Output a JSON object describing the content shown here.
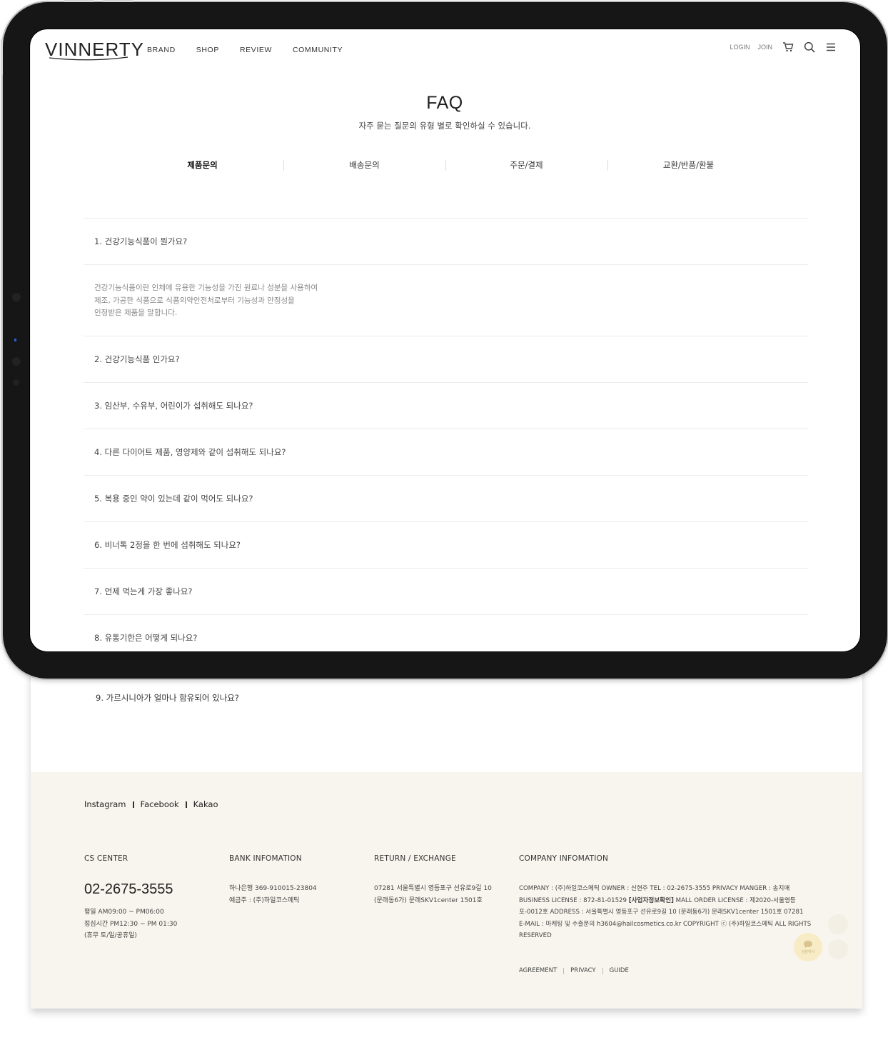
{
  "header": {
    "logo": "VINNERTY",
    "nav": [
      "BRAND",
      "SHOP",
      "REVIEW",
      "COMMUNITY"
    ],
    "login": "LOGIN",
    "join": "JOIN",
    "icons": [
      "cart-icon",
      "search-icon",
      "menu-icon"
    ]
  },
  "faq": {
    "title": "FAQ",
    "subtitle": "자주 묻는 질문의 유형 별로 확인하실 수 있습니다.",
    "tabs": [
      "제품문의",
      "배송문의",
      "주문/결제",
      "교환/반품/환불"
    ],
    "active_tab": "제품문의",
    "items": [
      {
        "q": "1. 건강기능식품이 뭔가요?",
        "a": [
          "건강기능식품이란 인체에 유용한 기능성을 가진 원료나 성분을 사용하여",
          "제조, 가공한 식품으로 식품의약안전처로부터 기능성과 안정성을",
          "인정받은 제품을 말합니다."
        ]
      },
      {
        "q": "2. 건강기능식품 인가요?"
      },
      {
        "q": "3. 임산부, 수유부, 어린이가 섭취해도 되나요?"
      },
      {
        "q": "4. 다른 다이어트 제품, 영양제와 같이 섭취해도 되나요?"
      },
      {
        "q": "5. 복용 중인 약이 있는데 같이 먹어도 되나요?"
      },
      {
        "q": "6. 비너톡 2정을 한 번에 섭취해도 되나요?"
      },
      {
        "q": "7. 언제 먹는게 가장 좋나요?"
      },
      {
        "q": "8. 유통기한은 어떻게 되나요?"
      },
      {
        "q": "9. 가르시니아가 얼마나 함유되어 있나요?"
      }
    ]
  },
  "footer": {
    "social": [
      "Instagram",
      "Facebook",
      "Kakao"
    ],
    "cs": {
      "head": "CS CENTER",
      "phone": "02-2675-3555",
      "hours": [
        "평일 AM09:00 ~ PM06:00",
        "점심시간 PM12:30 ~ PM 01:30",
        "(휴무 토/일/공휴일)"
      ]
    },
    "bank": {
      "head": "BANK INFOMATION",
      "lines": [
        "하나은행 369-910015-23804",
        "예금주 : (주)하일코스메틱"
      ]
    },
    "return": {
      "head": "RETURN / EXCHANGE",
      "lines": [
        "07281 서울특별시 영등포구 선유로9길 10",
        "(문래동6가) 문래SKV1center 1501호"
      ]
    },
    "company": {
      "head": "COMPANY INFOMATION",
      "line1": "COMPANY : (주)하일코스메틱  OWNER : 신현주   TEL : 02-2675-3555  PRIVACY MANGER : 송지애",
      "line2a": "BUSINESS LICENSE : 872-81-01529 ",
      "line2b": "[사업자정보확인]",
      "line2c": "  MALL ORDER LICENSE : 제2020-서울영등",
      "line3": "포-0012호   ADDRESS : 서울특별시 영등포구 선유로9길 10 (문래동6가) 문래SKV1center 1501호 07281",
      "line4": "E-MAIL : 마케팅 및 수출문의 h3604@hailcosmetics.co.kr   COPYRIGHT ⓒ (주)하일코스메틱 ALL RIGHTS",
      "line5": "RESERVED"
    },
    "links": [
      "AGREEMENT",
      "PRIVACY",
      "GUIDE"
    ],
    "chat_label": "상담하기"
  }
}
